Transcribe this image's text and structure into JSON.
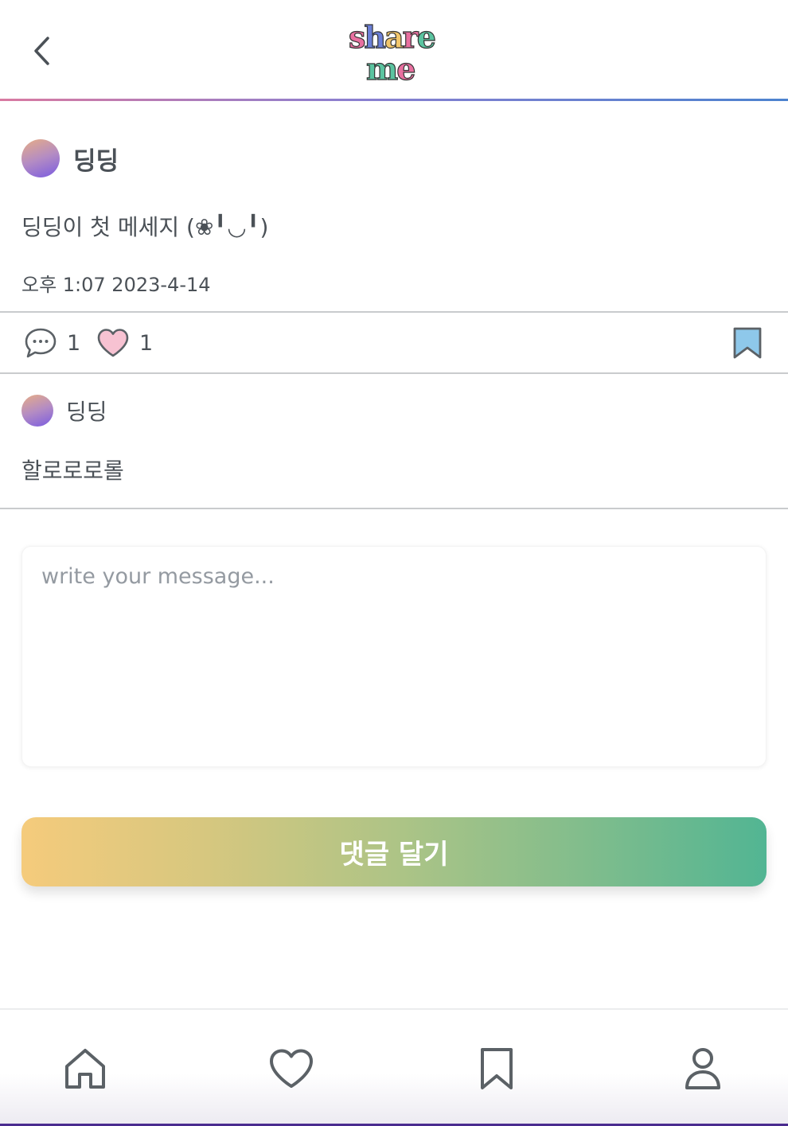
{
  "header": {
    "logo_line1": "share",
    "logo_line2": "me",
    "back_icon": "chevron-left-icon"
  },
  "post": {
    "author": "딩딩",
    "text": "딩딩이 첫 메세지 (❀╹◡╹)",
    "time": "오후 1:07 2023-4-14"
  },
  "actions": {
    "comment_count": "1",
    "like_count": "1",
    "comment_icon": "speech-bubble-icon",
    "like_icon": "heart-icon",
    "bookmark_icon": "bookmark-icon"
  },
  "comments": [
    {
      "author": "딩딩",
      "text": "할로로로롤"
    }
  ],
  "composer": {
    "placeholder": "write your message...",
    "value": ""
  },
  "submit": {
    "label": "댓글 달기"
  },
  "nav": [
    {
      "icon": "home-icon"
    },
    {
      "icon": "heart-icon"
    },
    {
      "icon": "bookmark-icon"
    },
    {
      "icon": "user-icon"
    }
  ],
  "colors": {
    "accent_pink": "#d97aa1",
    "accent_blue": "#4c83cf",
    "like_fill": "#f7c2d2",
    "bookmark_fill": "#8ec8ea",
    "button_start": "#f5cb7c",
    "button_end": "#52b593",
    "text": "#4b5157"
  }
}
